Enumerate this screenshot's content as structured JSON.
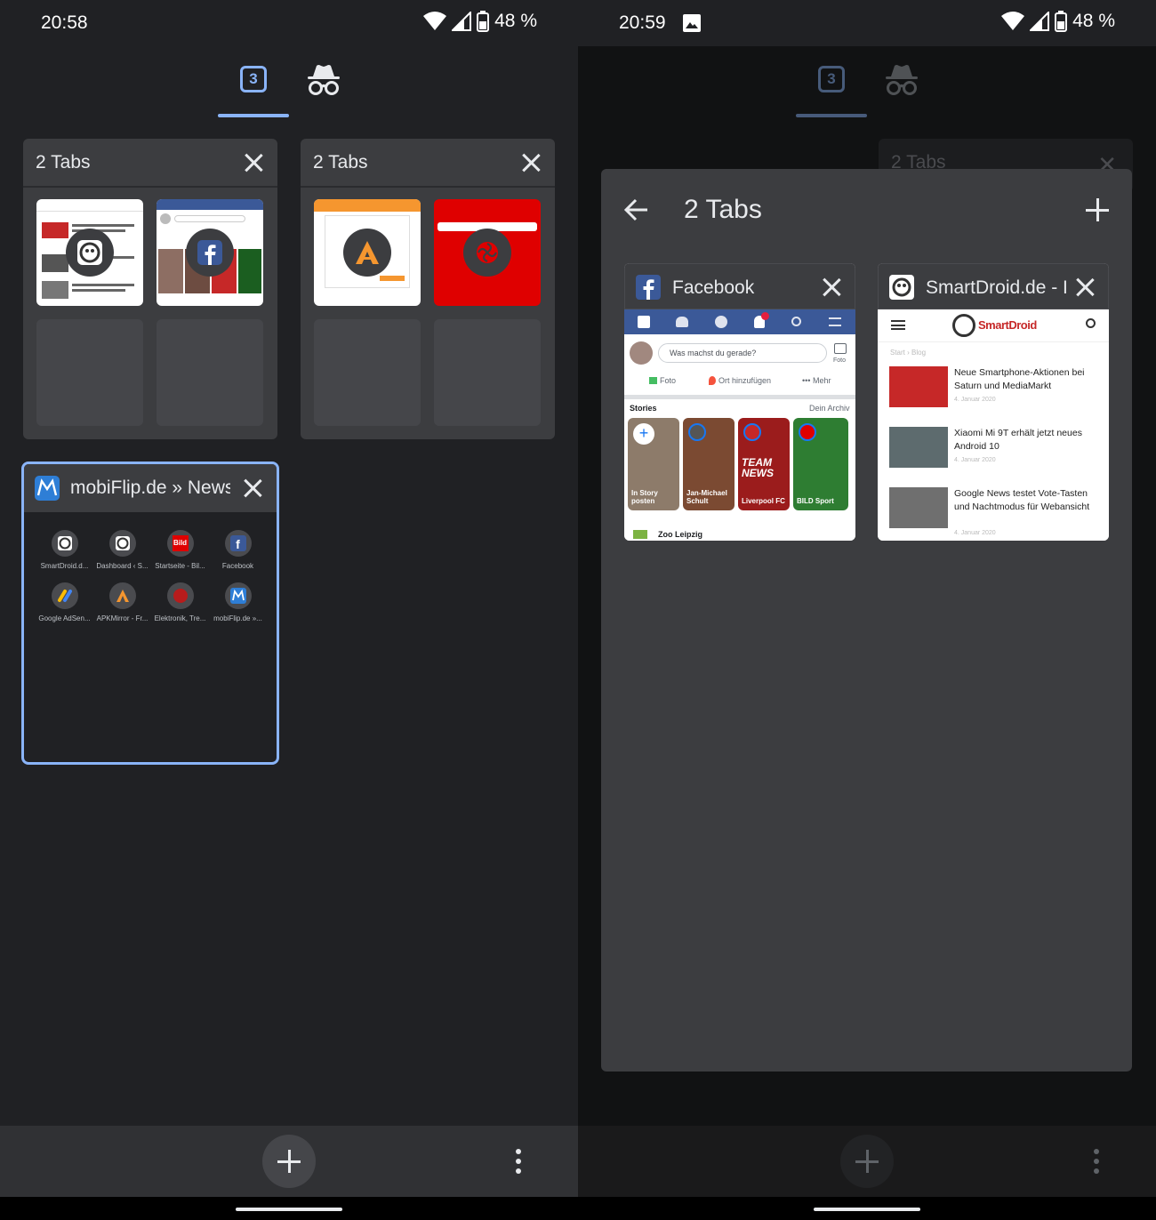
{
  "left": {
    "status": {
      "time": "20:58",
      "battery": "48 %"
    },
    "switcher": {
      "tab_count": "3"
    },
    "groups": [
      {
        "title": "2 Tabs",
        "tabs": [
          "SmartDroid",
          "Facebook"
        ]
      },
      {
        "title": "2 Tabs",
        "tabs": [
          "APKMirror",
          "MediaMarkt"
        ]
      }
    ],
    "mobiflip": {
      "title": "mobiFlip.de » News",
      "tiles": [
        {
          "label": "SmartDroid.d...",
          "icon": "smartdroid-icon"
        },
        {
          "label": "Dashboard ‹ S...",
          "icon": "smartdroid-icon"
        },
        {
          "label": "Startseite - Bil...",
          "icon": "bild-icon"
        },
        {
          "label": "Facebook",
          "icon": "facebook-icon"
        },
        {
          "label": "Google AdSen...",
          "icon": "adsense-icon"
        },
        {
          "label": "APKMirror - Fr...",
          "icon": "apkmirror-icon"
        },
        {
          "label": "Elektronik, Tre...",
          "icon": "mediamarkt-icon"
        },
        {
          "label": "mobiFlip.de »...",
          "icon": "mobiflip-icon"
        }
      ]
    }
  },
  "right": {
    "status": {
      "time": "20:59",
      "battery": "48 %"
    },
    "switcher": {
      "tab_count": "3"
    },
    "background_group_title": "2 Tabs",
    "dialog": {
      "title": "2 Tabs",
      "tabs": [
        {
          "title": "Facebook",
          "content": {
            "composer_placeholder": "Was machst du gerade?",
            "photo_label": "Foto",
            "actions": [
              "Foto",
              "Ort hinzufügen",
              "••• Mehr"
            ],
            "stories_label": "Stories",
            "archive_label": "Dein Archiv",
            "stories": [
              "In Story posten",
              "Jan-Michael Schult",
              "Liverpool FC",
              "BILD Sport"
            ],
            "story_overlay": "TEAM NEWS",
            "footer": "Zoo Leipzig"
          }
        },
        {
          "title": "SmartDroid.de - I",
          "content": {
            "logo": "SmartDroid",
            "breadcrumb": "Start › Blog",
            "articles": [
              {
                "title": "Neue Smartphone-Aktionen bei Saturn und MediaMarkt",
                "date": "4. Januar 2020"
              },
              {
                "title": "Xiaomi Mi 9T erhält jetzt neues Android 10",
                "date": "4. Januar 2020"
              },
              {
                "title": "Google News testet Vote-Tasten und Nachtmodus für Webansicht",
                "date": "4. Januar 2020"
              }
            ]
          }
        }
      ]
    }
  },
  "colors": {
    "accent": "#8ab4f8",
    "background": "#202124",
    "card": "#3c3d40",
    "facebook": "#3b5998",
    "mediamarkt": "#df0000",
    "apkmirror": "#f5962f"
  }
}
